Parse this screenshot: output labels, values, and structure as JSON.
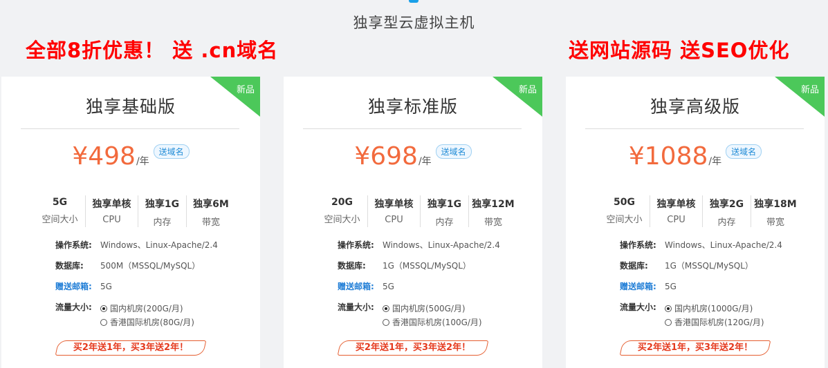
{
  "header": {
    "title": "独享型云虚拟主机",
    "promo_left": "全部8折优惠！ 送 .cn域名",
    "promo_right": "送网站源码  送SEO优化"
  },
  "colors": {
    "accent": "#f26a3d",
    "ribbon": "#4cc85a",
    "promo": "#ff0000",
    "link": "#1f7dd6"
  },
  "cards": [
    {
      "ribbon": "新品",
      "name": "独享基础版",
      "price": "¥498",
      "unit": "/年",
      "price_badge": "送域名",
      "specs": [
        {
          "value": "5G",
          "label": "空间大小"
        },
        {
          "value": "独享单核",
          "label": "CPU"
        },
        {
          "value": "独享1G",
          "label": "内存"
        },
        {
          "value": "独享6M",
          "label": "带宽"
        }
      ],
      "os_label": "操作系统:",
      "os_value": "Windows、Linux-Apache/2.4",
      "db_label": "数据库:",
      "db_value": "500M（MSSQL/MySQL）",
      "mail_label": "赠送邮箱:",
      "mail_value": "5G",
      "traffic_label": "流量大小:",
      "traffic_options": [
        "国内机房(200G/月)",
        "香港国际机房(80G/月)"
      ],
      "promo": "买2年送1年，买3年送2年！"
    },
    {
      "ribbon": "新品",
      "name": "独享标准版",
      "price": "¥698",
      "unit": "/年",
      "price_badge": "送域名",
      "specs": [
        {
          "value": "20G",
          "label": "空间大小"
        },
        {
          "value": "独享单核",
          "label": "CPU"
        },
        {
          "value": "独享1G",
          "label": "内存"
        },
        {
          "value": "独享12M",
          "label": "带宽"
        }
      ],
      "os_label": "操作系统:",
      "os_value": "Windows、Linux-Apache/2.4",
      "db_label": "数据库:",
      "db_value": "1G（MSSQL/MySQL）",
      "mail_label": "赠送邮箱:",
      "mail_value": "5G",
      "traffic_label": "流量大小:",
      "traffic_options": [
        "国内机房(500G/月)",
        "香港国际机房(100G/月)"
      ],
      "promo": "买2年送1年，买3年送2年！"
    },
    {
      "ribbon": "新品",
      "name": "独享高级版",
      "price": "¥1088",
      "unit": "/年",
      "price_badge": "送域名",
      "specs": [
        {
          "value": "50G",
          "label": "空间大小"
        },
        {
          "value": "独享单核",
          "label": "CPU"
        },
        {
          "value": "独享2G",
          "label": "内存"
        },
        {
          "value": "独享18M",
          "label": "带宽"
        }
      ],
      "os_label": "操作系统:",
      "os_value": "Windows、Linux-Apache/2.4",
      "db_label": "数据库:",
      "db_value": "1G（MSSQL/MySQL）",
      "mail_label": "赠送邮箱:",
      "mail_value": "5G",
      "traffic_label": "流量大小:",
      "traffic_options": [
        "国内机房(1000G/月)",
        "香港国际机房(120G/月)"
      ],
      "promo": "买2年送1年，买3年送2年！"
    }
  ]
}
